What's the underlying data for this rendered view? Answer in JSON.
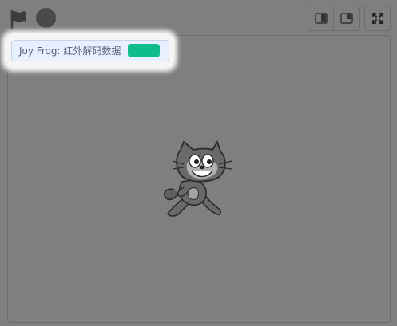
{
  "toolbar": {
    "green_flag_icon": "green-flag-icon",
    "stop_icon": "stop-sign-icon",
    "small_stage_icon": "small-stage-icon",
    "normal_stage_icon": "normal-stage-icon",
    "fullscreen_icon": "fullscreen-icon"
  },
  "stage": {
    "monitor": {
      "label": "Joy Frog: 红外解码数据",
      "value": ""
    },
    "sprite": {
      "name": "cat-sprite"
    }
  },
  "colors": {
    "stage_background": "#7f7f7f",
    "monitor_background": "#e6f0ff",
    "monitor_value": "#0fbd8c",
    "icon_dark": "#3f3f3f"
  }
}
